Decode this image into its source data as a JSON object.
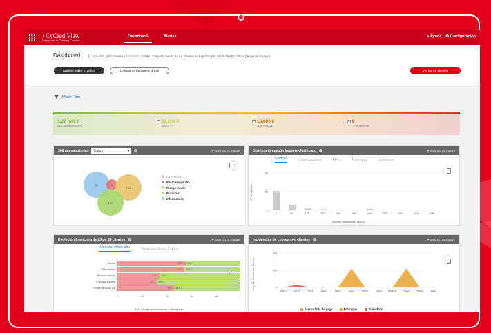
{
  "app": {
    "title": "CyCred View",
    "subtitle": "Un servicio de Crédito y Caución"
  },
  "nav": {
    "dashboard": "Dashboard",
    "alertas": "Alertas",
    "ayuda": "Ayuda",
    "config": "Configuración"
  },
  "page": {
    "title": "Dashboard",
    "description": "Visualiza gráficamente información sobre el comportamiento de tus clientes en tu póliza y la calidad de tu cartera (riesgo de impago)",
    "btn_analysis": "Análisis sobre tu póliza",
    "btn_quality": "Calidad de tu cartera global",
    "btn_clients": "Ver los 89 clientes",
    "add_filter": "Añadir Filtro"
  },
  "kpis": [
    {
      "value": "3,27 mill €",
      "label": "81 clasificaciones",
      "color": "#7cb342"
    },
    {
      "value": "12.606 €",
      "label": "20 AFP",
      "color": "#c0ca33"
    },
    {
      "value": "10.000 €",
      "label": "1 prórrogas",
      "color": "#ef6c00"
    },
    {
      "value": "0",
      "label": "1 siniestros",
      "color": "#d32f2f"
    }
  ],
  "panels": {
    "alerts": {
      "title": "366 nuevas alertas",
      "select": "Todos",
      "filterable": "GRÁFICO FILTRABLE",
      "legend": [
        {
          "label": "Cancelados",
          "color": "#d9b3c6"
        },
        {
          "label": "Resto riesgo alto",
          "color": "#e57373"
        },
        {
          "label": "Riesgo medio",
          "color": "#e6c36b"
        },
        {
          "label": "Positivos",
          "color": "#a5d66b"
        },
        {
          "label": "Informativos",
          "color": "#8fc4e8"
        }
      ],
      "bubbles": {
        "b1": "98",
        "b2": "8",
        "b3": "164",
        "b4": "100"
      }
    },
    "distribution": {
      "title": "Distribución según importe clasificado",
      "filterable": "GRÁFICO FILTRABLE",
      "tabs": [
        "Clientes",
        "Clasificaciones",
        "AFPs",
        "Prórrogas",
        "Siniestros"
      ],
      "ylabel": "Nº de clientes",
      "xlabel": "Importe clasificación (euros)",
      "yticks": [
        "100",
        "50",
        "0"
      ],
      "xticks": [
        "0",
        "6K",
        "12K",
        "24K",
        "36K",
        "50K",
        "100K",
        "250K",
        "500K",
        "1mill",
        "2mill"
      ]
    },
    "evolution": {
      "title": "Evolución financiera de 89 de 89 clientes",
      "filterable": "GRÁFICO FILTRABLE",
      "tabs": [
        "Variación último año",
        "Variación últimos 2 años"
      ],
      "rows": [
        "Ventas",
        "Resultados",
        "Fondos propios",
        "Fondo maniobra",
        "Deuda bancaria c/p"
      ],
      "xticks": [
        "0",
        "20",
        "40",
        "60",
        "80",
        "100"
      ],
      "xlabel": "% de clientes que aumentan o disminuyen"
    },
    "incidents": {
      "title": "Incidencias de cobros con clientes",
      "filterable": "GRÁFICO FILTRABLE",
      "ylabel": "Importe incidencias (euros)",
      "yticks": [
        "20k",
        "10k",
        "0"
      ],
      "xticks": [
        "May21",
        "Jun21",
        "Jul21",
        "Ago21",
        "Sep21",
        "Oct21",
        "Nov21",
        "Dic21",
        "Ene22",
        "Feb22",
        "Mar22",
        "Abr22"
      ],
      "legend": [
        {
          "label": "Avisos falta de pago",
          "color": "#e6a32e"
        },
        {
          "label": "Prórrogas",
          "color": "#f0a030"
        },
        {
          "label": "Siniestros",
          "color": "#e35040"
        }
      ]
    }
  },
  "chart_data": [
    {
      "type": "bar",
      "title": "Distribución según importe clasificado",
      "categories": [
        "0",
        "6K",
        "12K",
        "24K",
        "36K",
        "50K",
        "100K",
        "250K",
        "500K",
        "1mill",
        "2mill"
      ],
      "values": [
        52,
        15,
        5,
        3,
        2,
        1,
        4,
        1,
        0,
        0,
        0
      ],
      "ylim": [
        0,
        100
      ],
      "ylabel": "Nº de clientes",
      "xlabel": "Importe clasificación (euros)"
    },
    {
      "type": "bar",
      "title": "Evolución financiera de 89 de 89 clientes",
      "categories": [
        "Ventas",
        "Resultados",
        "Fondos propios",
        "Fondo maniobra",
        "Deuda bancaria c/p"
      ],
      "series": [
        {
          "name": "disminuyen",
          "values": [
            55,
            54,
            34,
            32,
            46
          ]
        },
        {
          "name": "aumentan",
          "values": [
            45,
            46,
            66,
            68,
            54
          ]
        }
      ],
      "xlabel": "% de clientes que aumentan o disminuyen",
      "xlim": [
        0,
        100
      ]
    },
    {
      "type": "area",
      "title": "Incidencias de cobros con clientes",
      "x": [
        "May21",
        "Jun21",
        "Jul21",
        "Ago21",
        "Sep21",
        "Oct21",
        "Nov21",
        "Dic21",
        "Ene22",
        "Feb22",
        "Mar22",
        "Abr22"
      ],
      "series": [
        {
          "name": "Avisos falta de pago",
          "values": [
            0,
            0,
            0,
            0,
            0,
            11000,
            0,
            0,
            0,
            11000,
            0,
            0
          ]
        },
        {
          "name": "Siniestros",
          "values": [
            0,
            1500,
            0,
            0,
            0,
            0,
            0,
            0,
            0,
            0,
            0,
            0
          ]
        }
      ],
      "ylim": [
        0,
        20000
      ],
      "ylabel": "Importe incidencias (euros)"
    }
  ]
}
